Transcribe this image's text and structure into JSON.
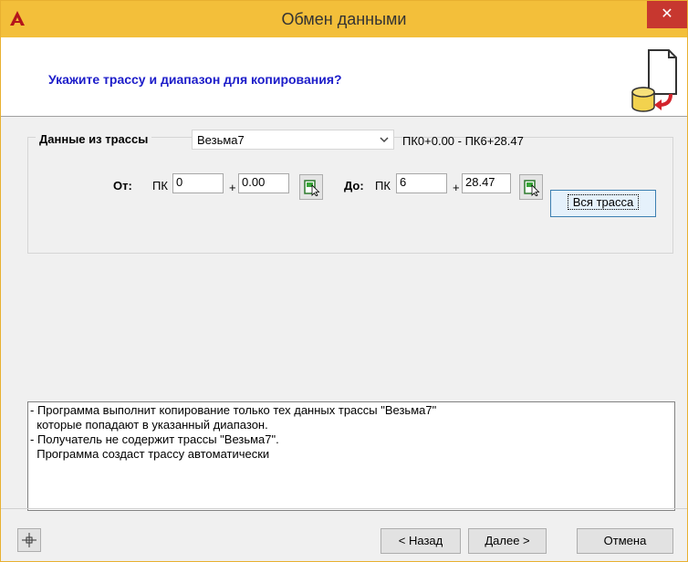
{
  "window": {
    "title": "Обмен данными",
    "close_icon": "close-icon",
    "app_icon": "autocad-icon"
  },
  "header": {
    "prompt": "Укажите трассу и диапазон для копирования?",
    "icon": "database-transfer-icon"
  },
  "route_group": {
    "label": "Данные из трассы",
    "route_select": {
      "value": "Везьма7"
    },
    "range": "ПК0+0.00 - ПК6+28.47",
    "from": {
      "label": "От:",
      "pk_label": "ПК",
      "pk_value": "0",
      "plus": "+",
      "offset_value": "0.00"
    },
    "to": {
      "label": "До:",
      "pk_label": "ПК",
      "pk_value": "6",
      "plus": "+",
      "offset_value": "28.47"
    },
    "whole_route_button": "Вся трасса"
  },
  "info": {
    "lines": [
      "- Программа выполнит копирование только тех данных трассы \"Везьма7\"",
      "  которые попадают в указанный диапазон.",
      "- Получатель не содержит трассы \"Везьма7\".",
      "  Программа создаст трассу автоматически"
    ]
  },
  "footer": {
    "back_button": "< Назад",
    "next_button": "Далее >",
    "cancel_button": "Отмена"
  },
  "colors": {
    "titlebar": "#f3bf3a",
    "close": "#c7372f",
    "header_text": "#1c1cc9"
  }
}
